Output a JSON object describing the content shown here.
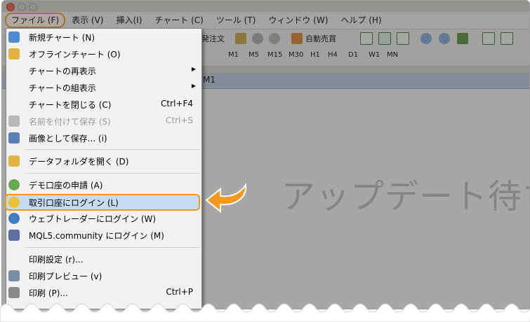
{
  "menubar": {
    "items": [
      {
        "label": "ファイル (F)",
        "active": true
      },
      {
        "label": "表示 (V)"
      },
      {
        "label": "挿入(I)"
      },
      {
        "label": "チャート (C)"
      },
      {
        "label": "ツール (T)"
      },
      {
        "label": "ウィンドウ (W)"
      },
      {
        "label": "ヘルプ (H)"
      }
    ]
  },
  "toolbar": {
    "order_text": "発注文",
    "auto_trade": "自動売買",
    "timeframes": [
      "M1",
      "M5",
      "M15",
      "M30",
      "H1",
      "H4",
      "D1",
      "W1",
      "MN"
    ]
  },
  "chart": {
    "tab_text": "M1",
    "watermark": "アップデート待ち"
  },
  "file_menu": {
    "items": [
      {
        "label": "新規チャート (N)",
        "icon": "new-chart-icon"
      },
      {
        "label": "オフラインチャート (O)",
        "icon": "folder-open-icon"
      },
      {
        "label": "チャートの再表示",
        "submenu": true
      },
      {
        "label": "チャートの組表示",
        "submenu": true
      },
      {
        "label": "チャートを閉じる (C)",
        "shortcut": "Ctrl+F4"
      },
      {
        "label": "名前を付けて保存 (S)",
        "shortcut": "Ctrl+S",
        "disabled": true,
        "icon": "save-icon"
      },
      {
        "label": "画像として保存... (i)",
        "icon": "save-image-icon"
      },
      {
        "label": "データフォルダを開く (D)",
        "icon": "folder-icon"
      },
      {
        "label": "デモ口座の申請 (A)",
        "icon": "demo-account-icon"
      },
      {
        "label": "取引口座にログイン (L)",
        "icon": "login-account-icon",
        "highlight": true
      },
      {
        "label": "ウェブトレーダーにログイン (W)",
        "icon": "webtrader-icon"
      },
      {
        "label": "MQL5.community にログイン (M)",
        "icon": "mql5-icon"
      },
      {
        "label": "印刷設定 (r)..."
      },
      {
        "label": "印刷プレビュー (v)",
        "icon": "print-preview-icon"
      },
      {
        "label": "印刷 (P)...",
        "shortcut": "Ctrl+P",
        "icon": "print-icon"
      }
    ]
  },
  "colors": {
    "highlight_border": "#f39a1e",
    "highlight_fill": "#c7dcf2",
    "menu_bg": "#f2f2f2"
  }
}
